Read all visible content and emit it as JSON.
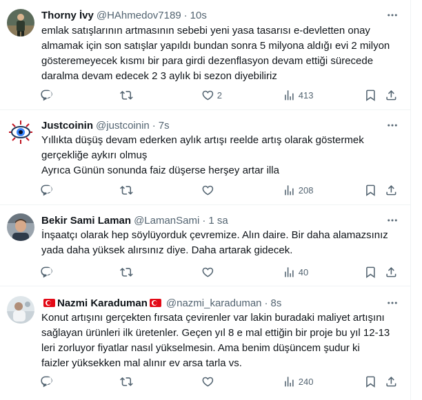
{
  "tweets": [
    {
      "name": "Thorny İvy",
      "handle": "@HAhmedov7189",
      "time": "10s",
      "lines": [
        "emlak satışlarının artmasının sebebi yeni yasa tasarısı e-devletten onay",
        "almamak için son satışlar yapıldı bundan sonra 5 milyona aldığı evi 2 milyon",
        "gösteremeyecek kısmı bir para girdi dezenflasyon devam ettiği sürecede",
        "daralma devam edecek 2 3 aylık bi sezon diyebiliriz"
      ],
      "likes": "2",
      "views": "413"
    },
    {
      "name": "Justcoinin",
      "handle": "@justcoinin",
      "time": "7s",
      "lines": [
        "Yıllıkta düşüş devam ederken aylık artışı reelde artış olarak göstermek",
        "gerçekliğe aykırı olmuş",
        "Ayrıca Günün sonunda faiz düşerse herşey artar illa"
      ],
      "likes": "",
      "views": "208"
    },
    {
      "name": "Bekir Sami Laman",
      "handle": "@LamanSami",
      "time": "1 sa",
      "lines": [
        "İnşaatçı olarak hep söylüyorduk çevremize. Alın daire. Bir daha alamazsınız",
        "yada daha yüksek alırsınız diye. Daha artarak gidecek."
      ],
      "likes": "",
      "views": "40"
    },
    {
      "name": "Nazmi Karaduman",
      "handle": "@nazmi_karaduman",
      "time": "8s",
      "lines": [
        "Konut artışını gerçekten fırsata çevirenler var lakin buradaki maliyet artışını",
        "sağlayan ürünleri ilk üretenler. Geçen yıl 8 e mal ettiğin bir proje bu yıl 12-13",
        "leri zorluyor fiyatlar nasıl yükselmesin. Ama benim düşüncem şudur ki",
        "faizler yüksekken mal alınır ev arsa tarla vs."
      ],
      "likes": "",
      "views": "240"
    }
  ],
  "icons": {
    "reply": "reply-icon",
    "retweet": "retweet-icon",
    "like": "heart-icon",
    "views": "views-icon",
    "bookmark": "bookmark-icon",
    "share": "share-icon",
    "more": "more-icon"
  },
  "colors": {
    "text": "#0f1419",
    "secondary": "#536471",
    "border": "#eff3f4",
    "flag_red": "#e30a17"
  }
}
